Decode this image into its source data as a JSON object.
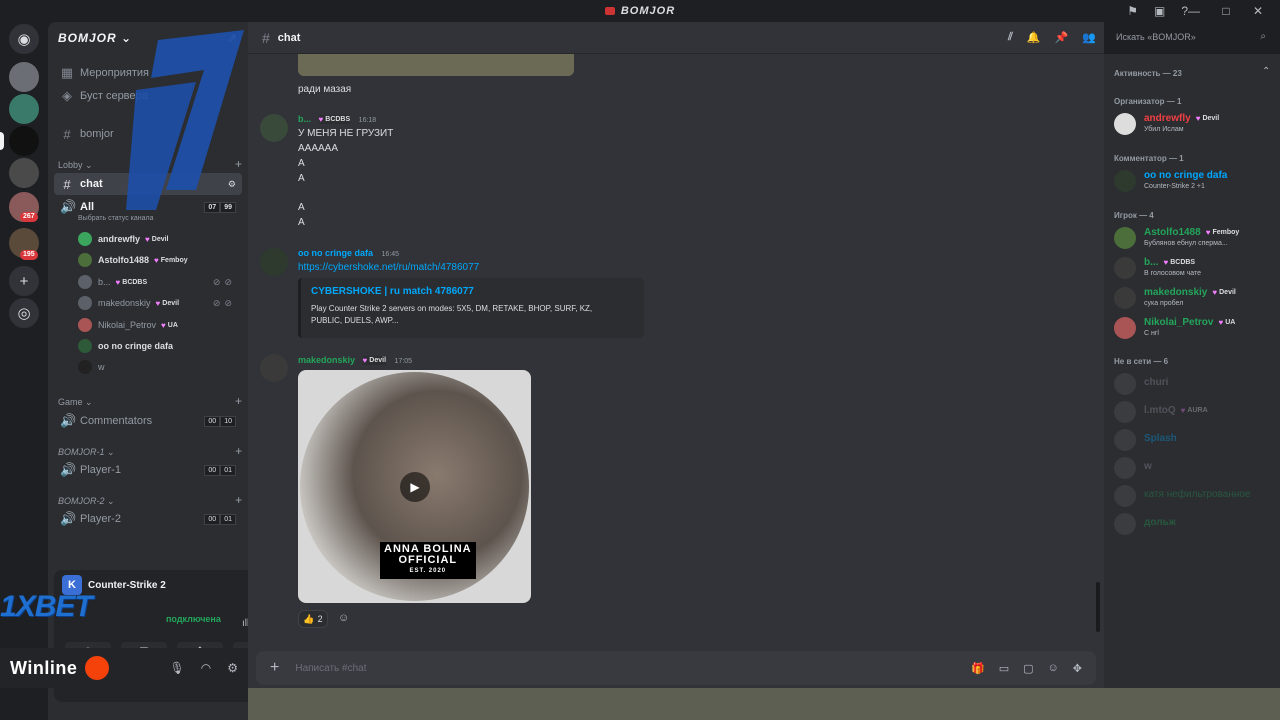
{
  "window": {
    "title": "BOMJOR",
    "controls": [
      "—",
      "□",
      "✕"
    ]
  },
  "guild": {
    "name": "BOMJOR"
  },
  "rail": {
    "badges": [
      "267",
      "195"
    ]
  },
  "sidebar": {
    "top_items": [
      {
        "label": "Мероприятия",
        "icon": "calendar-icon"
      },
      {
        "label": "Буст сервера",
        "icon": "boost-icon"
      },
      {
        "label": "bomjor",
        "icon": "hash-icon"
      }
    ],
    "categories": {
      "lobby": "Lobby",
      "game": "Game",
      "bomjor1": "BOMJOR-1",
      "bomjor2": "BOMJOR-2"
    },
    "active_channel": "chat",
    "voice_all": {
      "label": "All",
      "counts": [
        "07",
        "99"
      ],
      "status_hint": "Выбрать статус канала"
    },
    "voice_members": [
      {
        "name": "andrewfly",
        "tag": "Devil"
      },
      {
        "name": "Astolfo1488",
        "tag": "Femboy"
      },
      {
        "name": "b...",
        "tag": "BCDBS"
      },
      {
        "name": "makedonskiy",
        "tag": "Devil"
      },
      {
        "name": "Nikolai_Petrov",
        "tag": "UA"
      },
      {
        "name": "oo no cringe dafa",
        "tag": ""
      },
      {
        "name": "w",
        "tag": ""
      }
    ],
    "commentators": {
      "label": "Commentators",
      "counts": [
        "00",
        "10"
      ]
    },
    "player1": {
      "label": "Player-1",
      "counts": [
        "00",
        "01"
      ]
    },
    "player2": {
      "label": "Player-2",
      "counts": [
        "00",
        "01"
      ]
    }
  },
  "voice_panel": {
    "game": "Counter-Strike 2",
    "status": "подключена",
    "sponsor1": "1XBET",
    "sponsor2": "Winline"
  },
  "chat": {
    "channel": "chat",
    "search_placeholder": "Искать «BOMJOR»",
    "composer_placeholder": "Написать #chat",
    "messages": [
      {
        "text": "ради мазая"
      },
      {
        "author": "b...",
        "tag": "BCDBS",
        "time": "16:18",
        "lines": [
          "У МЕНЯ НЕ ГРУЗИТ",
          "АААААА",
          "А",
          "А",
          "",
          "А",
          "А"
        ]
      },
      {
        "author": "oo no cringe dafa",
        "time": "16:45",
        "link": "https://cybershoke.net/ru/match/4786077",
        "embed_title": "CYBERSHOKE | ru match 4786077",
        "embed_desc_1": "Play Counter Strike 2 servers on modes: 5X5, DM, RETAKE, BHOP, SURF, KZ,",
        "embed_desc_2": "PUBLIC, DUELS, AWP..."
      },
      {
        "author": "makedonskiy",
        "tag": "Devil",
        "time": "17:05",
        "video_text_1": "ANNA BOLINA",
        "video_text_2": "OFFICIAL",
        "video_text_3": "EST. 2020",
        "reaction_count": "2"
      }
    ]
  },
  "members": {
    "activity_header": "Активность — 23",
    "organizer_header": "Организатор — 1",
    "commentator_header": "Комментатор — 1",
    "players_header": "Игрок — 4",
    "offline_header": "Не в сети — 6",
    "list": [
      {
        "name": "andrewfly",
        "tag": "Devil",
        "status": "Убил Ислам",
        "color": "#f23f43"
      },
      {
        "name": "oo no cringe dafa",
        "status": "Counter-Strike 2 +1",
        "color": "#00a8fc"
      },
      {
        "name": "Astolfo1488",
        "tag": "Femboy",
        "status": "Бублянов ебнул сперма...",
        "color": "#23a55a"
      },
      {
        "name": "b...",
        "tag": "BCDBS",
        "status": "В голосовом чате",
        "color": "#23a55a"
      },
      {
        "name": "makedonskiy",
        "tag": "Devil",
        "status": "сука пробел",
        "color": "#23a55a"
      },
      {
        "name": "Nikolai_Petrov",
        "tag": "UA",
        "status": "С нгl",
        "color": "#23a55a"
      }
    ],
    "offline": [
      {
        "name": "churi"
      },
      {
        "name": "l.mtoQ",
        "tag": "AURA"
      },
      {
        "name": "Splash"
      },
      {
        "name": "w"
      },
      {
        "name": "катя нефильтрованное"
      },
      {
        "name": "дольж"
      }
    ]
  }
}
